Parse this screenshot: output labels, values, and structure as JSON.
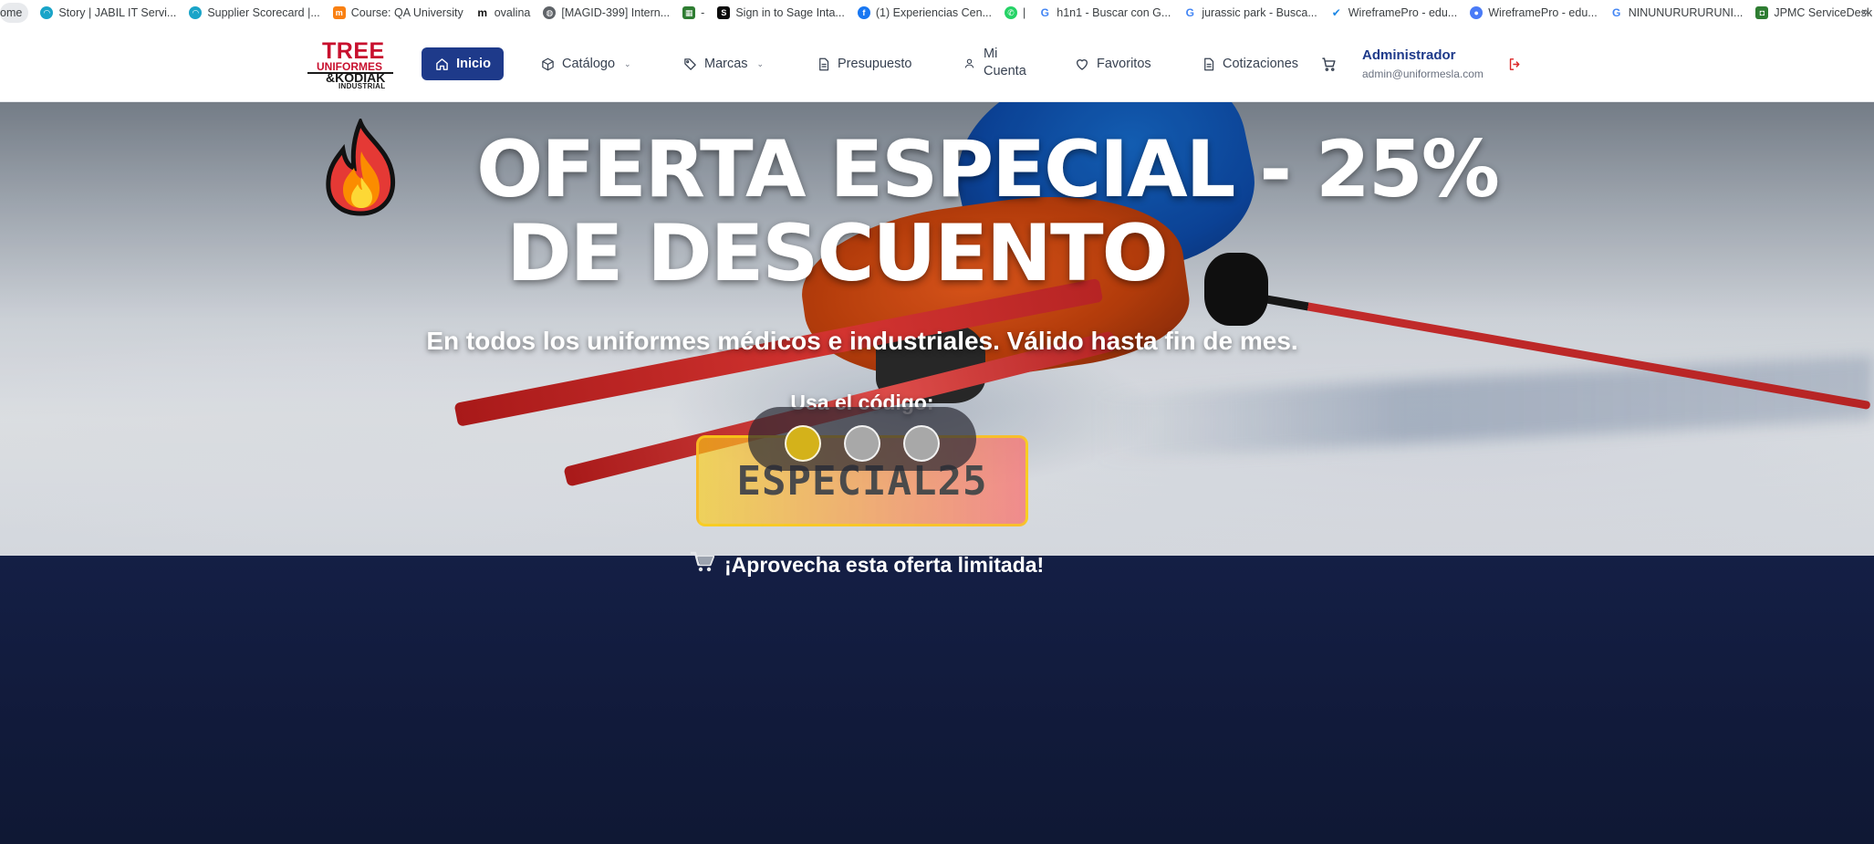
{
  "bookmarks": [
    {
      "label": "ome",
      "icon": "home-icon"
    },
    {
      "label": "Story | JABIL IT Servi...",
      "icon": "headset-icon"
    },
    {
      "label": "Supplier Scorecard |...",
      "icon": "headset-icon"
    },
    {
      "label": "Course: QA University",
      "icon": "moodle-icon"
    },
    {
      "label": "ovalina",
      "icon": "m-icon"
    },
    {
      "label": "[MAGID-399] Intern...",
      "icon": "globe-icon"
    },
    {
      "label": "-",
      "icon": "grid-icon"
    },
    {
      "label": "Sign in to Sage Inta...",
      "icon": "sage-icon"
    },
    {
      "label": "(1) Experiencias Cen...",
      "icon": "facebook-icon"
    },
    {
      "label": "|",
      "icon": "whatsapp-icon"
    },
    {
      "label": "h1n1 - Buscar con G...",
      "icon": "google-icon"
    },
    {
      "label": "jurassic park - Busca...",
      "icon": "google-icon"
    },
    {
      "label": "WireframePro - edu...",
      "icon": "wireframe-icon"
    },
    {
      "label": "WireframePro - edu...",
      "icon": "toggle-icon"
    },
    {
      "label": "NINUNURURURUNI...",
      "icon": "google-icon"
    },
    {
      "label": "JPMC ServiceDesk",
      "icon": "servicedesk-icon"
    }
  ],
  "bookmarks_more": "»",
  "logo": {
    "line1": "TREE",
    "line2": "UNIFORMES",
    "line3": "&KODIAK",
    "line4": "INDUSTRIAL"
  },
  "nav": {
    "home": "Inicio",
    "catalogo": "Catálogo",
    "marcas": "Marcas",
    "presupuesto": "Presupuesto",
    "cuenta_line1": "Mi",
    "cuenta_line2": "Cuenta",
    "favoritos": "Favoritos",
    "cotizaciones": "Cotizaciones"
  },
  "user": {
    "name": "Administrador",
    "email": "admin@uniformesla.com"
  },
  "hero": {
    "title_line1": "OFERTA ESPECIAL - 25%",
    "title_line2": "DE DESCUENTO",
    "subtitle": "En todos los uniformes médicos e industriales. Válido hasta fin de mes.",
    "code_label": "Usa el código:",
    "code": "ESPECIAL25",
    "promo": "¡Aprovecha esta oferta limitada!",
    "slides": 3,
    "active_slide": 1
  },
  "colors": {
    "primary": "#1e3a8a",
    "logo_red": "#c8102e",
    "dark_band": "#111a3a",
    "code_yellow": "#facc15",
    "code_red": "#f87171"
  }
}
